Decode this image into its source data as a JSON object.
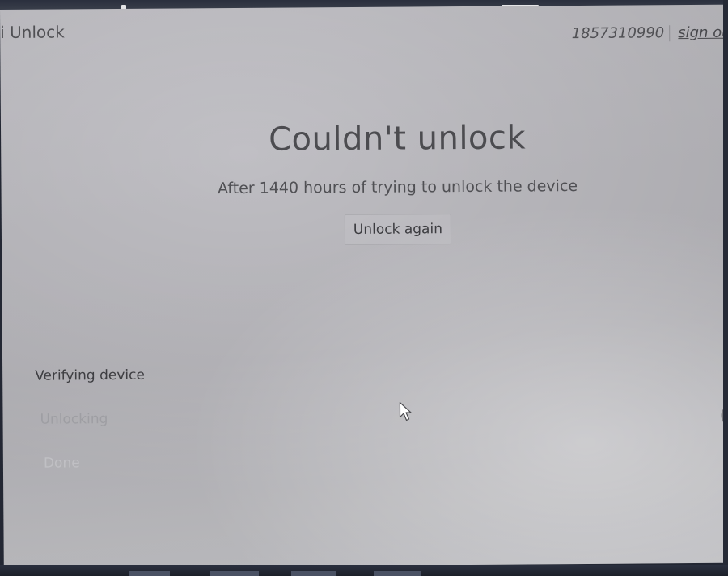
{
  "app": {
    "title": "i Unlock"
  },
  "header": {
    "account_number": "1857310990",
    "sign_out_label": "sign out"
  },
  "result": {
    "title": "Couldn't unlock",
    "message": "After 1440 hours of trying to unlock the device",
    "button_label": "Unlock again"
  },
  "steps": [
    {
      "label": "Verifying device",
      "state": "active"
    },
    {
      "label": "Unlocking",
      "state": "pending"
    },
    {
      "label": "Done",
      "state": "pending"
    }
  ],
  "colors": {
    "screen_background": "#c5c4c9",
    "text": "#4a4a4e",
    "bezel": "#232733"
  },
  "icons": {
    "cursor": "mouse-pointer-icon"
  }
}
